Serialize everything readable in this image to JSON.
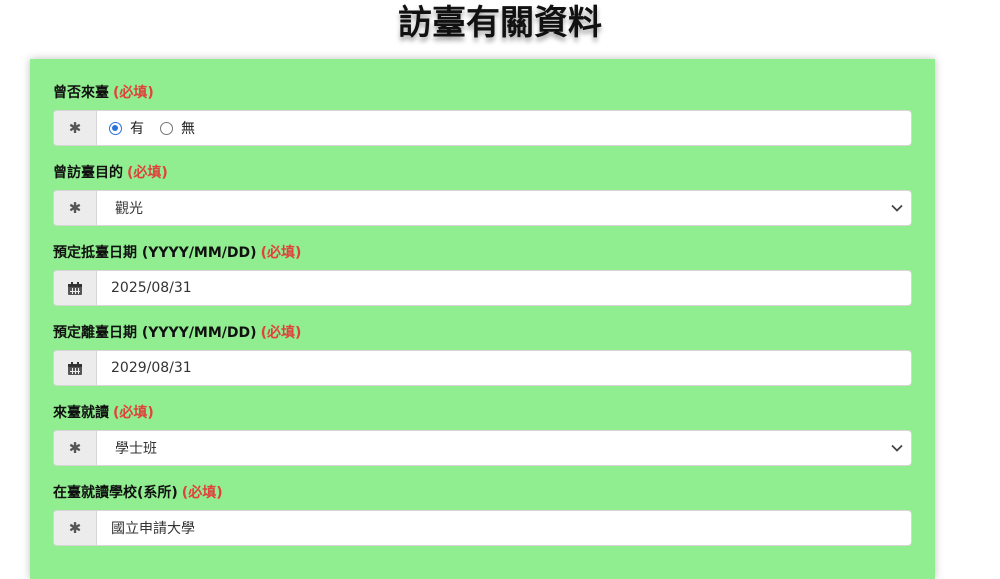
{
  "title": "訪臺有關資料",
  "required_mark": "(必填)",
  "fields": {
    "visited": {
      "label": "曾否來臺",
      "icon": "asterisk-icon",
      "options": [
        "有",
        "無"
      ],
      "selected": "有"
    },
    "purpose": {
      "label": "曾訪臺目的",
      "icon": "asterisk-icon",
      "value": "觀光"
    },
    "arrival": {
      "label": "預定抵臺日期 (YYYY/MM/DD)",
      "icon": "calendar-icon",
      "value": "2025/08/31"
    },
    "departure": {
      "label": "預定離臺日期 (YYYY/MM/DD)",
      "icon": "calendar-icon",
      "value": "2029/08/31"
    },
    "study_level": {
      "label": "來臺就讀",
      "icon": "asterisk-icon",
      "value": "學士班"
    },
    "school": {
      "label": "在臺就讀學校(系所)",
      "icon": "asterisk-icon",
      "value": "國立申請大學"
    }
  },
  "colors": {
    "panel_bg": "#90ee90",
    "required": "#e0413d",
    "radio_active": "#2a73d9"
  }
}
